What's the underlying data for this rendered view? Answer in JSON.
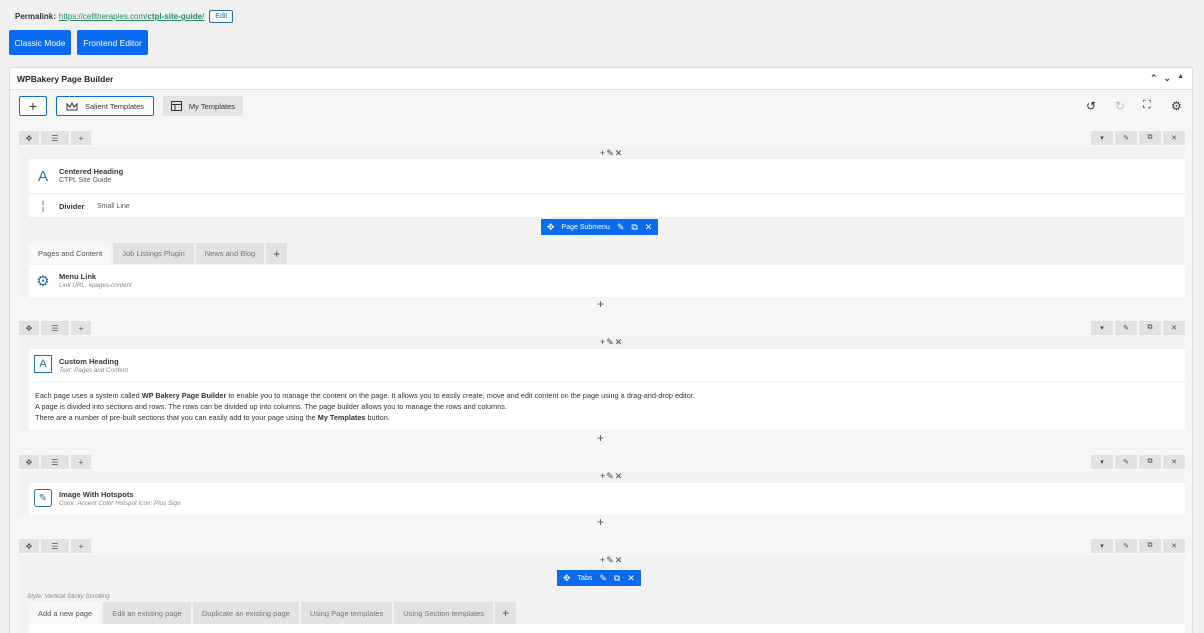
{
  "permalink": {
    "label": "Permalink:",
    "url_base": "https://celltherapies.com/",
    "url_slug": "ctpl-site-guide",
    "url_end": "/",
    "edit_label": "Edit"
  },
  "modes": {
    "classic": "Classic Mode",
    "frontend": "Frontend Editor"
  },
  "builder": {
    "title": "WPBakery Page Builder",
    "toolbar": {
      "add_label": "+",
      "salient_label": "Salient Templates",
      "my_templates_label": "My Templates"
    }
  },
  "rows": {
    "r1": {
      "heading": {
        "title": "Centered Heading",
        "sub": "CTPL Site Guide"
      },
      "divider": {
        "title": "Divider",
        "sub": "Small Line"
      },
      "submenu_label": "Page Submenu",
      "tabs": [
        "Pages and Content",
        "Job Listings Plugin",
        "News and Blog"
      ],
      "menu_link": {
        "title": "Menu Link",
        "sub": "Link URL: #pages-content"
      }
    },
    "r2": {
      "heading": {
        "title": "Custom Heading",
        "sub": "Text: Pages and Content"
      },
      "text": {
        "p1_a": "Each page uses a system called ",
        "p1_b": "WP Bakery Page Builder",
        "p1_c": " to enable you to manage the content on the page. It allows you to easily create, move and edit content on the page using a drag-and-drop editor.",
        "p2": "A page is divided into sections and rows. The rows can be divided up into columns. The page builder allows you to manage the rows and columns.",
        "p3_a": "There are a number of pre-built sections that you can easily add to your page using the ",
        "p3_b": "My Templates",
        "p3_c": " button."
      }
    },
    "r3": {
      "hotspot": {
        "title": "Image With Hotspots",
        "sub": "Color: Accent Color  Hotspot Icon: Plus Sign"
      }
    },
    "r4": {
      "tabs_label": "Tabs",
      "style": "Style: Vertical Sticky Scrolling",
      "tabs": [
        "Add a new page",
        "Edit an existing page",
        "Duplicate an existing page",
        "Using Page templates",
        "Using Section templates"
      ]
    }
  },
  "colors": {
    "accent": "#0a6bf0",
    "link": "#2a8a62"
  }
}
